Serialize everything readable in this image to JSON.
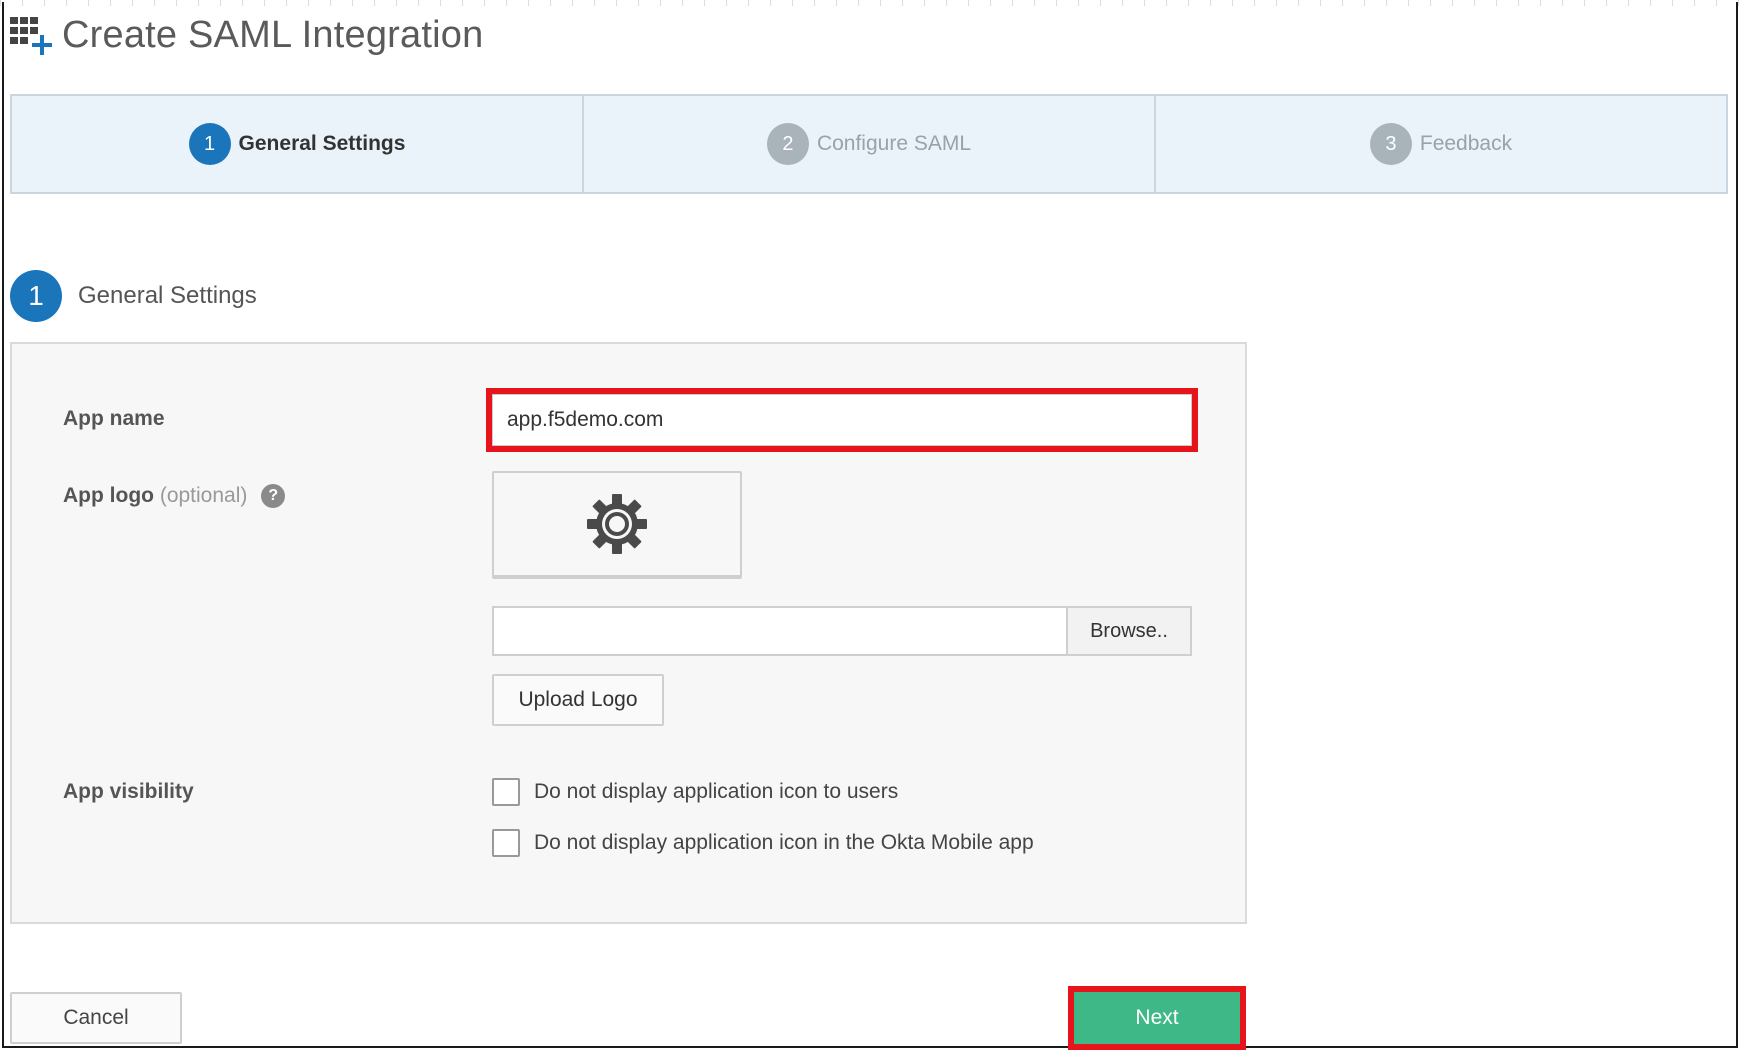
{
  "header": {
    "title": "Create SAML Integration",
    "icon": "app-grid-plus-icon"
  },
  "wizard": {
    "steps": [
      {
        "number": "1",
        "label": "General Settings",
        "active": true
      },
      {
        "number": "2",
        "label": "Configure SAML",
        "active": false
      },
      {
        "number": "3",
        "label": "Feedback",
        "active": false
      }
    ]
  },
  "section": {
    "number": "1",
    "title": "General Settings"
  },
  "form": {
    "app_name": {
      "label": "App name",
      "value": "app.f5demo.com"
    },
    "app_logo": {
      "label": "App logo",
      "optional": "(optional)",
      "help": "?",
      "placeholder_icon": "gear-icon",
      "browse_label": "Browse..",
      "upload_label": "Upload Logo"
    },
    "app_visibility": {
      "label": "App visibility",
      "options": [
        {
          "label": "Do not display application icon to users",
          "checked": false
        },
        {
          "label": "Do not display application icon in the Okta Mobile app",
          "checked": false
        }
      ]
    }
  },
  "footer": {
    "cancel_label": "Cancel",
    "next_label": "Next"
  },
  "colors": {
    "accent": "#1b75bb",
    "next": "#3fb887",
    "highlight": "#e8141b"
  }
}
